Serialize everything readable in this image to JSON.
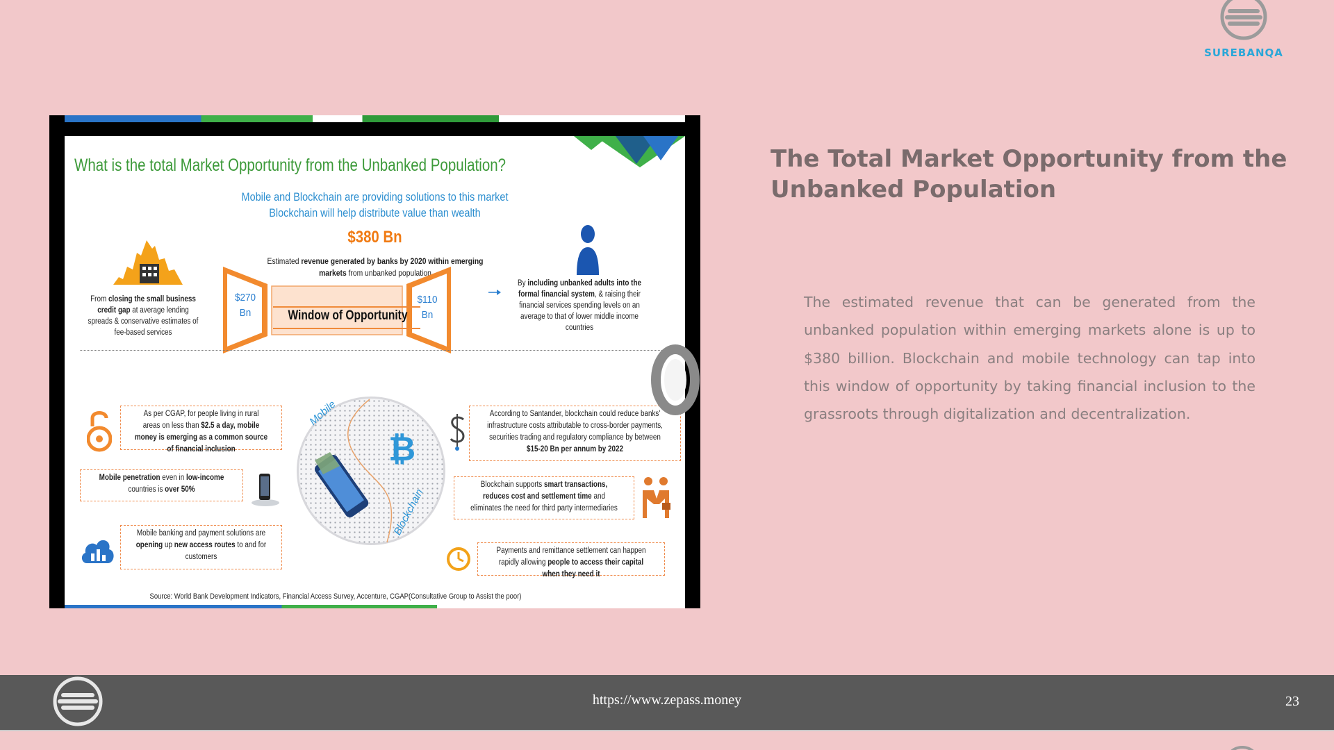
{
  "brand": {
    "name": "SUREBANQA",
    "logo_icon": "surebanqa-logo-icon"
  },
  "colors": {
    "background": "#f2c8ca",
    "footer": "#595959",
    "heading": "#7a6b6c",
    "body": "#8a7f80",
    "brand_blue": "#2ba7d8"
  },
  "infographic": {
    "title": "What is the total Market Opportunity from the Unbanked Population?",
    "subtitle_1": "Mobile and Blockchain are providing solutions to this market",
    "subtitle_2": "Blockchain will help distribute value than wealth",
    "total_amount": "$380 Bn",
    "estimate_html": "Estimated <b>revenue generated by banks by 2020 within emerging markets</b> from unbanked population",
    "left_note_html": "From <b>closing the small business credit gap</b> at average lending spreads &amp; conservative estimates of fee-based services",
    "left_value_line1": "$270",
    "left_value_line2": "Bn",
    "window_label": "Window of Opportunity",
    "right_value_line1": "$110",
    "right_value_line2": "Bn",
    "right_note_html": "By <b>including unbanked adults into the formal financial system</b>, &amp; raising their financial services spending levels on an average to that of lower middle income countries",
    "box_cgap_html": "As per CGAP, for people living in rural areas on less than <b>$2.5 a day, mobile money is emerging as a common source of financial inclusion</b>",
    "box_penetration_html": "<b>Mobile penetration</b> even in <b>low-income</b> countries is <b>over 50%</b>",
    "box_banking_html": "Mobile banking and payment solutions are <b>opening</b> up <b>new access routes</b> to and for customers",
    "box_santander_html": "According to Santander, blockchain could reduce banks' infrastructure costs attributable to cross-border payments, securities trading and regulatory compliance by between <b>$15-20 Bn per annum by 2022</b>",
    "box_smart_html": "Blockchain supports <b>smart transactions, reduces cost and settlement time</b> and eliminates the need for third party intermediaries",
    "box_payments_html": "Payments and remittance settlement can happen rapidly allowing <b>people to access their capital when they need it</b>",
    "circle_label_mobile": "Mobile",
    "circle_label_blockchain": "Blockchain",
    "source": "Source: World Bank Development Indicators, Financial Access Survey, Accenture, CGAP(Consultative Group to Assist the poor)",
    "icons": [
      "city-icon",
      "person-icon",
      "lock-icon",
      "phone-icon",
      "cloud-chart-icon",
      "dollar-icon",
      "handshake-icon",
      "clock-icon",
      "bitcoin-icon",
      "smartphone-icon"
    ]
  },
  "heading": "The Total Market Opportunity from the Unbanked Population",
  "body": "The estimated revenue that can be generated from the unbanked population within emerging markets alone is up to $380 billion. Blockchain and mobile technology can tap into this window of opportunity by taking financial inclusion to the grassroots through digitalization and decentralization.",
  "footer": {
    "url": "https://www.zepass.money",
    "page_number": "23"
  }
}
